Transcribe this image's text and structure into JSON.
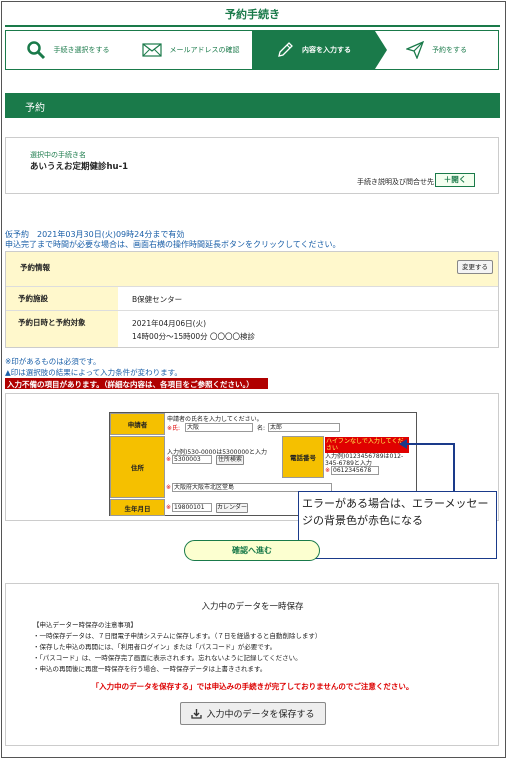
{
  "page": {
    "title": "予約手続き"
  },
  "steps": [
    {
      "label": "手続き選択をする",
      "icon": "search-icon"
    },
    {
      "label": "メールアドレスの確認",
      "icon": "mail-icon"
    },
    {
      "label": "内容を入力する",
      "icon": "pencil-icon",
      "active": true
    },
    {
      "label": "予約をする",
      "icon": "send-icon"
    }
  ],
  "section": {
    "title": "予約"
  },
  "procedure": {
    "label": "選択中の手続き名",
    "name": "あいうえお定期健診hu-1",
    "help_label": "手続き説明及び問合せ先",
    "open_button": "＋開く"
  },
  "reservation": {
    "line1": "仮予約　2021年03月30日(火)09時24分まで有効",
    "line2": "申込完了まで時間が必要な場合は、画面右横の操作時間延長ボタンをクリックしてください。"
  },
  "info": {
    "header_label": "予約情報",
    "change_button": "変更する",
    "facility_label": "予約施設",
    "facility_value": "B保健センター",
    "datetime_label": "予約日時と予約対象",
    "datetime_value1": "2021年04月06日(火)",
    "datetime_value2": "14時00分～15時00分 〇〇〇〇検診"
  },
  "notes": {
    "required": "※印があるものは必須です。",
    "conditional": "▲印は選択肢の結果によって入力条件が変わります。",
    "error": "入力不備の項目があります。（詳細な内容は、各項目をご参照ください。）"
  },
  "form": {
    "applicant_label": "申請者",
    "applicant_hint": "申請者の氏名を入力してください。",
    "sei_label": "※氏:",
    "sei_value": "大阪",
    "mei_label": "名:",
    "mei_value": "太郎",
    "address_label": "住所",
    "zip_hint": "入力例)530-0000は5300000と入力",
    "zip_value": "5300003",
    "zip_button": "住所検索",
    "address_value": "大阪府大阪市北区堂島",
    "phone_label": "電話番号",
    "phone_error": "ハイフンなしで入力してください",
    "phone_hint": "入力例)0123456789は012-345-6789と入力",
    "phone_value": "0612345678",
    "dob_label": "生年月日",
    "dob_value": "19800101",
    "calendar_button": "カレンダー",
    "required_mark": "※"
  },
  "callout": {
    "text": "エラーがある場合は、エラーメッセージの背景色が赤色になる"
  },
  "confirm_button": "確認へ進む",
  "save": {
    "title": "入力中のデータを一時保存",
    "notes": [
      "【申込データー時保存の注意事項】",
      "・一時保存データは、７日間電子申請システムに保存します。（７日を経過すると自動削除します）",
      "・保存した申込の再開には、「利用者ログイン」または「パスコード」が必要です。",
      "・「パスコード」は、一時保存完了画面に表示されます。忘れないように記録してください。",
      "・申込の再開後に再度一時保存を行う場合、一時保存データは上書きされます。"
    ],
    "warning": "「入力中のデータを保存する」では申込みの手続きが完了しておりませんのでご注意ください。",
    "button": "入力中のデータを保存する"
  }
}
